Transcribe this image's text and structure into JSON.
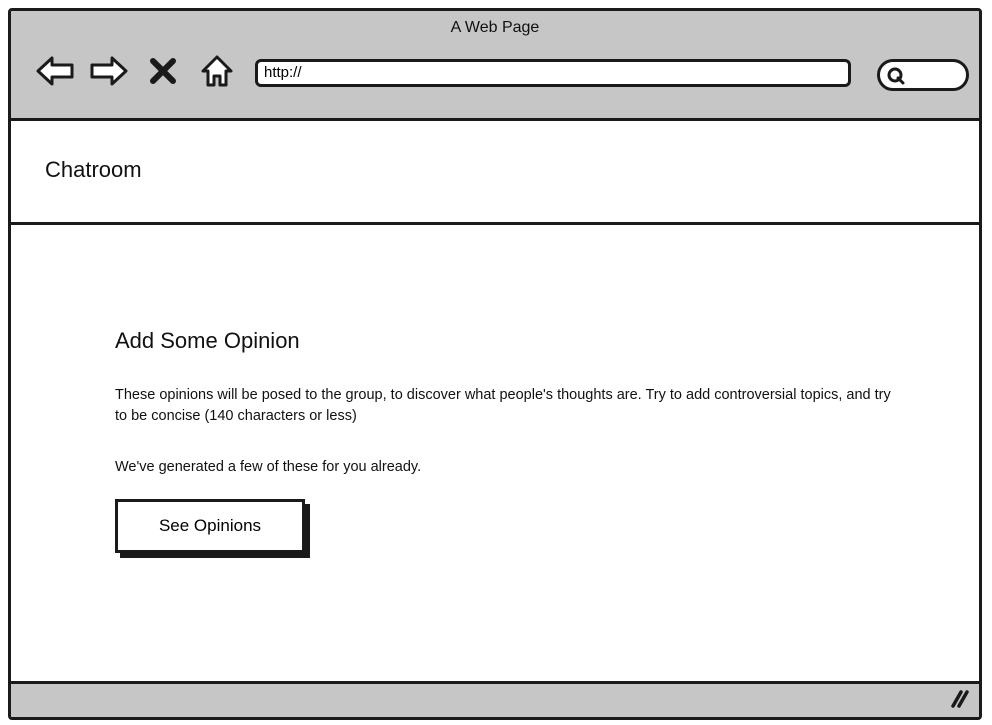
{
  "window": {
    "title": "A Web Page",
    "address_value": "http://"
  },
  "toolbar": {
    "icons": [
      "back-arrow-icon",
      "forward-arrow-icon",
      "close-x-icon",
      "home-icon"
    ],
    "search_icon": "search-icon"
  },
  "header": {
    "app_title": "Chatroom"
  },
  "main": {
    "heading": "Add Some Opinion",
    "paragraph_1": "These opinions will be posed to the group, to discover what people's thoughts are. Try to add controversial topics, and try to be concise (140 characters or less)",
    "paragraph_2": "We've generated a few of these for you already.",
    "button_label": "See Opinions"
  },
  "statusbar": {
    "resize_icon": "resize-grip-icon"
  }
}
